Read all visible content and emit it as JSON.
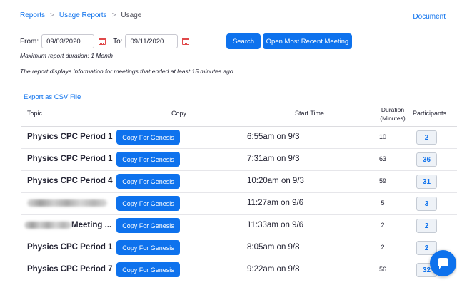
{
  "breadcrumb": {
    "items": [
      "Reports",
      "Usage Reports",
      "Usage"
    ],
    "separator": ">"
  },
  "document_link": "Document",
  "filters": {
    "from_label": "From:",
    "from_value": "09/03/2020",
    "to_label": "To:",
    "to_value": "09/11/2020",
    "calendar_icon": "calendar-icon"
  },
  "buttons": {
    "search": "Search",
    "open_recent": "Open Most Recent Meeting"
  },
  "notes": {
    "max_duration": "Maximum report duration: 1 Month",
    "info": "The report displays information for meetings that ended at least 15 minutes ago."
  },
  "export_link": "Export as CSV File",
  "table": {
    "headers": {
      "topic": "Topic",
      "copy": "Copy",
      "start_time": "Start Time",
      "duration_line1": "Duration",
      "duration_line2": "(Minutes)",
      "participants": "Participants"
    },
    "rows": [
      {
        "topic": "Physics CPC Period 1",
        "topic_redacted": false,
        "copy_label": "Copy For Genesis",
        "start_time": "6:55am on 9/3",
        "duration": "10",
        "participants": "2"
      },
      {
        "topic": "Physics CPC Period 1",
        "topic_redacted": false,
        "copy_label": "Copy For Genesis",
        "start_time": "7:31am on 9/3",
        "duration": "63",
        "participants": "36"
      },
      {
        "topic": "Physics CPC Period 4",
        "topic_redacted": false,
        "copy_label": "Copy For Genesis",
        "start_time": "10:20am on 9/3",
        "duration": "59",
        "participants": "31"
      },
      {
        "topic": "",
        "topic_redacted": true,
        "copy_label": "Copy For Genesis",
        "start_time": "11:27am on 9/6",
        "duration": "5",
        "participants": "3"
      },
      {
        "topic": "Meeting ...",
        "topic_redacted": true,
        "copy_label": "Copy For Genesis",
        "start_time": "11:33am on 9/6",
        "duration": "2",
        "participants": "2"
      },
      {
        "topic": "Physics CPC Period 1",
        "topic_redacted": false,
        "copy_label": "Copy For Genesis",
        "start_time": "8:05am on 9/8",
        "duration": "2",
        "participants": "2"
      },
      {
        "topic": "Physics CPC Period 7",
        "topic_redacted": false,
        "copy_label": "Copy For Genesis",
        "start_time": "9:22am on 9/8",
        "duration": "56",
        "participants": "32"
      }
    ]
  },
  "chat_widget": {
    "icon": "chat-bubble-icon"
  },
  "colors": {
    "accent": "#0e72ed",
    "calendar_icon": "#e0494a"
  }
}
